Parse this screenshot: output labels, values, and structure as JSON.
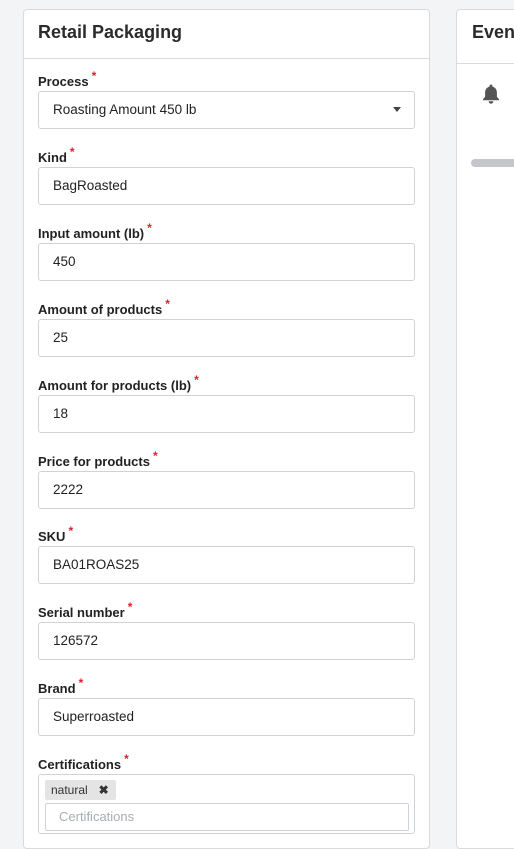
{
  "packaging": {
    "title": "Retail Packaging",
    "required_marker": "*",
    "fields": {
      "process": {
        "label": "Process",
        "value": "Roasting Amount 450 lb"
      },
      "kind": {
        "label": "Kind",
        "value": "BagRoasted"
      },
      "input_amount": {
        "label": "Input amount (lb)",
        "value": "450"
      },
      "amount_of_products": {
        "label": "Amount of products",
        "value": "25"
      },
      "amount_for_products": {
        "label": "Amount for products (lb)",
        "value": "18"
      },
      "price_for_products": {
        "label": "Price for products",
        "value": "2222"
      },
      "sku": {
        "label": "SKU",
        "value": "BA01ROAS25"
      },
      "serial_number": {
        "label": "Serial number",
        "value": "126572"
      },
      "brand": {
        "label": "Brand",
        "value": "Superroasted"
      },
      "certifications": {
        "label": "Certifications",
        "tags": [
          "natural"
        ],
        "tag_remove_glyph": "✖",
        "placeholder": "Certifications"
      }
    }
  },
  "events": {
    "title": "Event",
    "icon": "bell-icon",
    "icon_color": "#555555"
  }
}
